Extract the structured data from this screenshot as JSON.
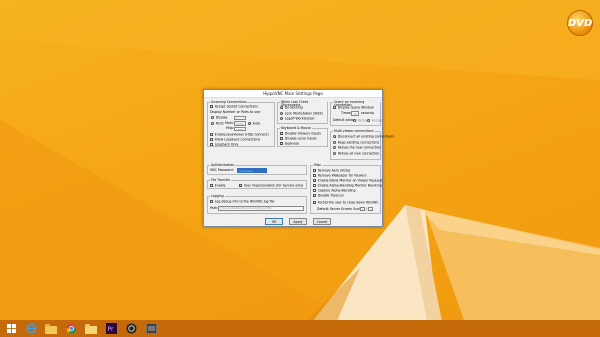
{
  "desktop": {
    "logo_text": "DVD",
    "colors": {
      "background": "#f5a616",
      "taskbar": "#c46a0a",
      "accent": "#3c7fb1"
    }
  },
  "taskbar": {
    "icons": [
      "windows-start-icon",
      "internet-explorer-icon",
      "file-explorer-icon",
      "chrome-icon",
      "folder-icon",
      "premiere-pro-icon",
      "obs-icon",
      "app-window-icon"
    ]
  },
  "dialog": {
    "title": "HippoVNC Main Settings Page",
    "incoming": {
      "title": "Incoming Connections",
      "accept_socket": "Accept Socket Connections",
      "display_number_label": "Display Number or Ports to use:",
      "display_label": "Display",
      "display_value": "0",
      "ports_label": "Ports",
      "main_label": "Main:",
      "main_value": "5900",
      "http_label": "Http:",
      "http_value": "5800",
      "auto_label": "Auto",
      "enable_javaviewer": "Enable JavaViewer (Http Connect)",
      "allow_loopback": "Allow Loopback Connections",
      "loopback_only": "Loopback Only"
    },
    "disconnect": {
      "title": "When Last Client Disconnects",
      "do_nothing": "Do Nothing",
      "lock": "Lock Workstation (W2K)",
      "logoff": "Logoff Workstation"
    },
    "keyboard": {
      "title": "Keyboard & Mouse",
      "disable_viewers": "Disable Viewers inputs",
      "disable_local": "Disable Local inputs",
      "japanese": "Japanese"
    },
    "query": {
      "title": "Query on incoming connection",
      "display_query": "Display Query Window",
      "timeout_label": "Timeout:",
      "timeout_value": "10",
      "seconds_label": "seconds",
      "default_action_label": "Default action:",
      "refuse_label": "Refuse",
      "accept_label": "Accept"
    },
    "multi": {
      "title": "Multi viewer connections",
      "disconnect_existing": "Disconnect all existing connections",
      "keep_existing": "Keep existing connections",
      "refuse_new": "Refuse the new connection",
      "refuse_all": "Refuse all new connection"
    },
    "auth": {
      "title": "Authentication",
      "vnc_password_label": "VNC Password:",
      "vnc_password_value": "••••••••"
    },
    "filetransfer": {
      "title": "File Transfer",
      "enable": "Enable",
      "user_impersonation": "User impersonation (for Service only)"
    },
    "logging": {
      "title": "Logging",
      "log_debug": "Log debug info to the WinVNC.log file",
      "path_label": "Path:",
      "path_value": "C:\\Users\\Desktop\\Downloads\\HippoVNC"
    },
    "misc": {
      "title": "Misc.",
      "remove_aero": "Remove Aero (Vista)",
      "remove_wallpaper": "Remove Wallpaper for Viewers",
      "enable_blank_monitor": "Enable Blank Monitor on Viewer Request",
      "enable_alpha_blending": "Enable Alpha-Blending Monitor Blanking",
      "capture_alpha": "Capture Alpha-Blending",
      "disable_trayicon": "Disable TrayIcon",
      "forbid_close": "Forbid the user to close down WinVNC",
      "default_scale_label": "Default Server Screen Scale:",
      "default_scale_value": "1",
      "scale_sep": "/",
      "scale_denominator": "1"
    },
    "buttons": {
      "ok": "OK",
      "apply": "Apply",
      "cancel": "Cancel"
    }
  }
}
